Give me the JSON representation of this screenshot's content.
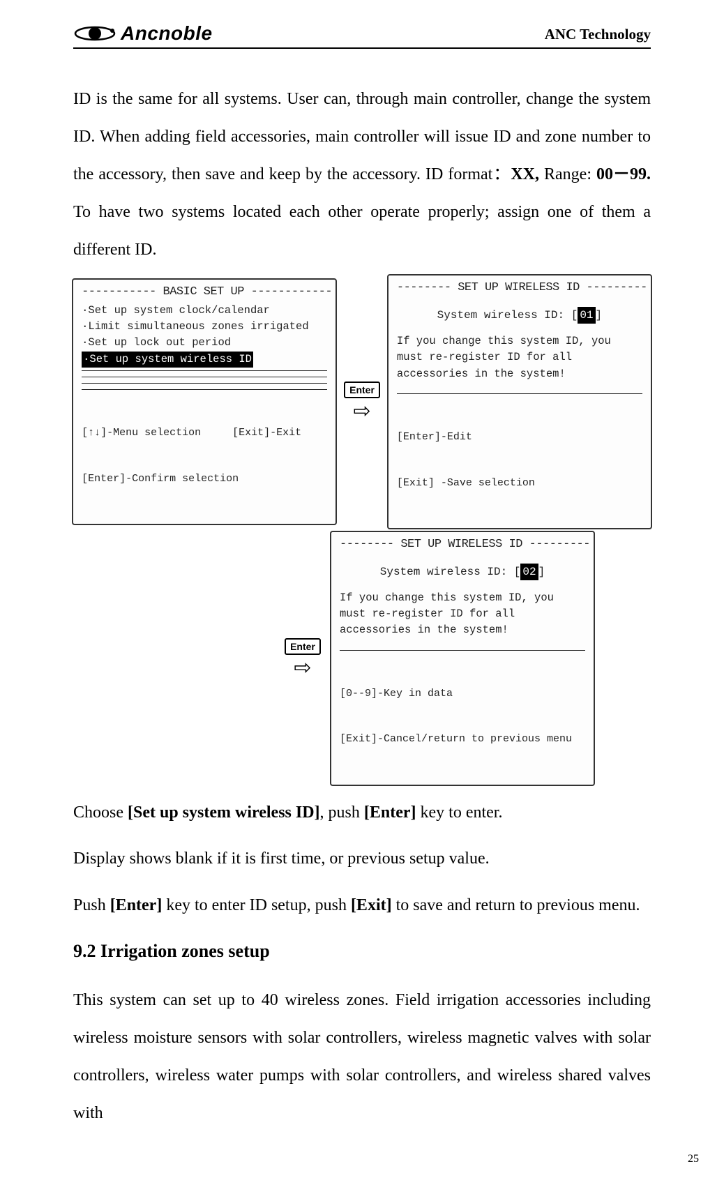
{
  "header": {
    "logo_text": "Ancnoble",
    "company": "ANC Technology"
  },
  "intro_paragraph": {
    "pre": "ID is the same for all systems. User can, through main controller, change the system ID. When adding field accessories, main controller will issue ID and zone number to the accessory, then save and keep by the accessory. ID format：",
    "b1": "XX,",
    "mid": " Range: ",
    "b2": "00－99.",
    "post": " To have two systems located each other operate properly; assign one of them a different ID."
  },
  "screen1": {
    "title": "----------- BASIC SET UP ------------",
    "items": [
      "·Set up system clock/calendar",
      "·Limit simultaneous zones irrigated",
      "·Set up lock out period",
      "·Set up system wireless ID"
    ],
    "hint1": "[↑↓]-Menu selection     [Exit]-Exit",
    "hint2": "[Enter]-Confirm selection"
  },
  "enter_label": "Enter",
  "arrow": "⇨",
  "screen2": {
    "title": "-------- SET UP WIRELESS ID ---------",
    "id_label": "System wireless ID:  [",
    "id_value": "01",
    "id_close": "]",
    "warn": "If you change this system ID, you must re-register ID for all accessories in the system!",
    "hint1": "[Enter]-Edit",
    "hint2": "[Exit] -Save selection"
  },
  "screen3": {
    "title": "-------- SET UP WIRELESS ID ---------",
    "id_label": "System wireless ID:  [",
    "id_value": "02",
    "id_close": "]",
    "warn": "If you change this system ID, you must re-register ID for all accessories in the system!",
    "hint1": "[0--9]-Key in data",
    "hint2": "[Exit]-Cancel/return to previous menu"
  },
  "instructions": {
    "l1_pre": "Choose ",
    "l1_b1": "[Set up system wireless ID]",
    "l1_mid": ", push ",
    "l1_b2": "[Enter]",
    "l1_post": " key to enter.",
    "l2": "Display shows blank if it is first time, or previous setup value.",
    "l3_pre": "Push ",
    "l3_b1": "[Enter]",
    "l3_mid": " key to enter ID setup, push ",
    "l3_b2": "[Exit]",
    "l3_post": " to save and return to previous menu."
  },
  "section_heading": "9.2 Irrigation zones setup",
  "section_body": "This system can set up to 40 wireless zones. Field irrigation accessories including wireless moisture sensors with solar controllers, wireless magnetic valves with solar controllers, wireless water pumps with solar controllers, and wireless shared valves with",
  "page_number": "25"
}
